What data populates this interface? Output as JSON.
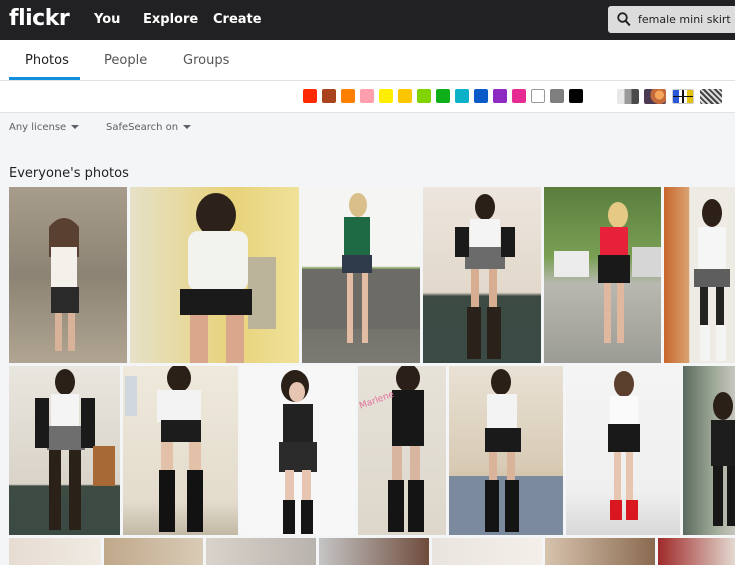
{
  "header": {
    "logo": "flickr",
    "nav": [
      "You",
      "Explore",
      "Create"
    ],
    "search_value": "female mini skirt"
  },
  "tabs": [
    "Photos",
    "People",
    "Groups"
  ],
  "active_tab": "Photos",
  "color_filters": [
    "#ff2a00",
    "#a8431e",
    "#ff7f00",
    "#ff9fad",
    "#ffee00",
    "#fbc600",
    "#7ed300",
    "#0fae1b",
    "#0bb2c7",
    "#0a5ac8",
    "#8e2bc3",
    "#e62c92",
    "#ffffff",
    "#7f7f7f",
    "#000000"
  ],
  "style_filters": [
    "black-and-white",
    "shallow-depth-of-field",
    "minimalist",
    "patterns"
  ],
  "filters": {
    "license": "Any license",
    "safesearch": "SafeSearch on"
  },
  "section_title": "Everyone's photos"
}
